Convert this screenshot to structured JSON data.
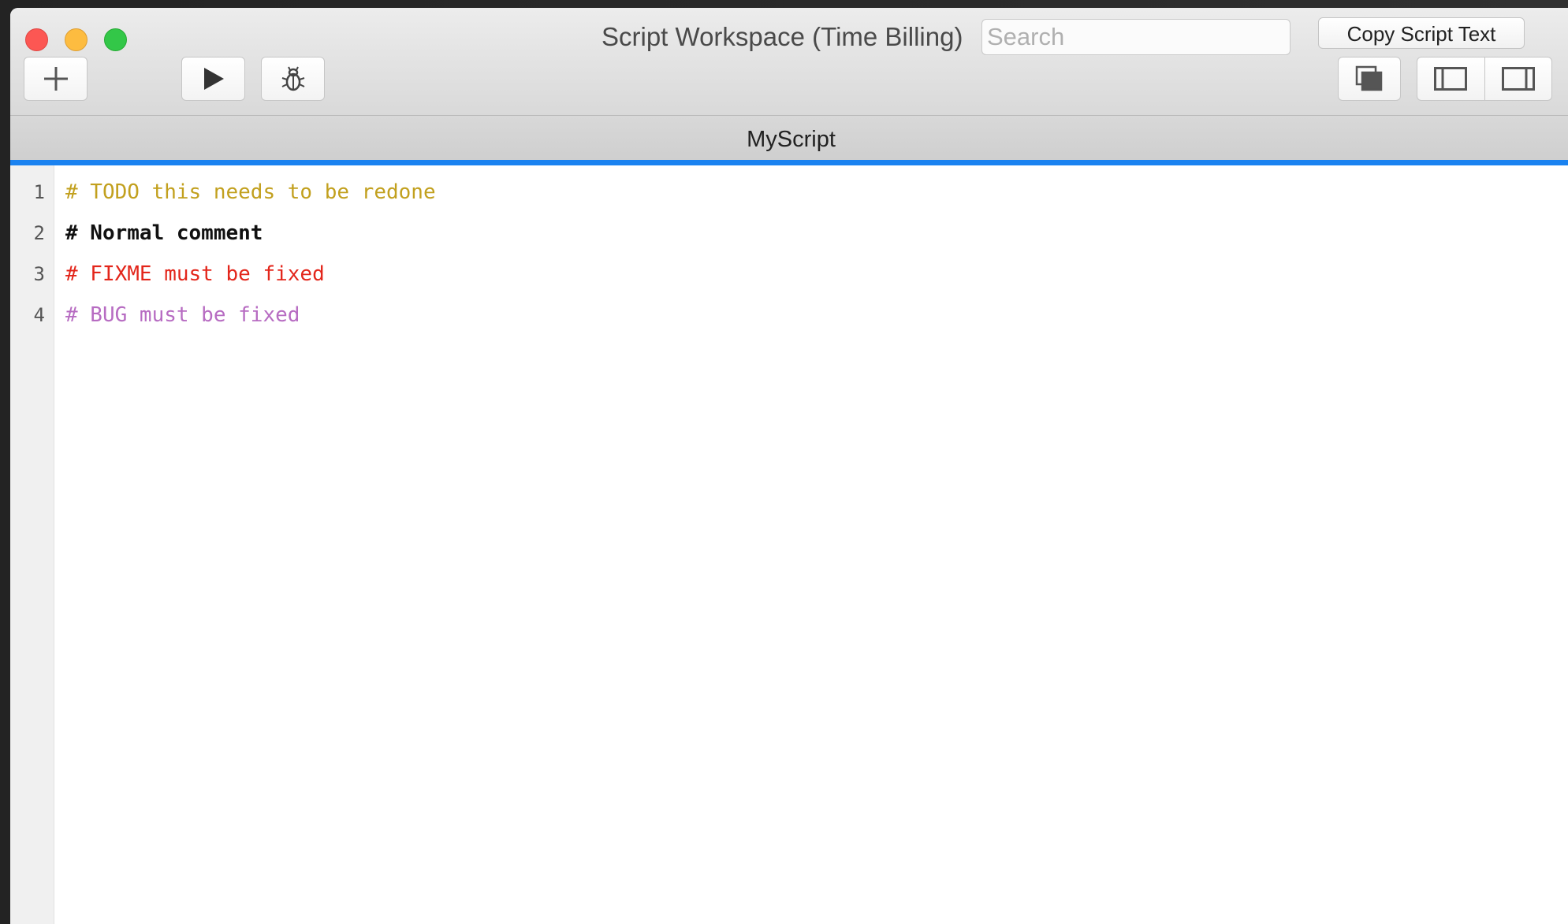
{
  "window": {
    "title": "Script Workspace (Time Billing)",
    "search_placeholder": "Search",
    "copy_button_label": "Copy Script Text"
  },
  "toolbar": {
    "add_icon": "plus-icon",
    "run_icon": "play-icon",
    "debug_icon": "bug-icon",
    "windows_icon": "stacked-windows-icon",
    "left_sidebar_icon": "left-sidebar-icon",
    "right_sidebar_icon": "right-sidebar-icon"
  },
  "tabs": [
    {
      "label": "MyScript",
      "active": true
    }
  ],
  "editor": {
    "lines": [
      {
        "number": "1",
        "text": "# TODO this needs to be redone",
        "color": "#c2a01e"
      },
      {
        "number": "2",
        "text": "# Normal comment",
        "color": "#111111"
      },
      {
        "number": "3",
        "text": "# FIXME must be fixed",
        "color": "#e3261b"
      },
      {
        "number": "4",
        "text": "# BUG must be fixed",
        "color": "#b76cc2"
      }
    ]
  },
  "colors": {
    "accent": "#1a82f0",
    "close": "#fc5753",
    "minimize": "#fdbc40",
    "maximize": "#33c748"
  }
}
